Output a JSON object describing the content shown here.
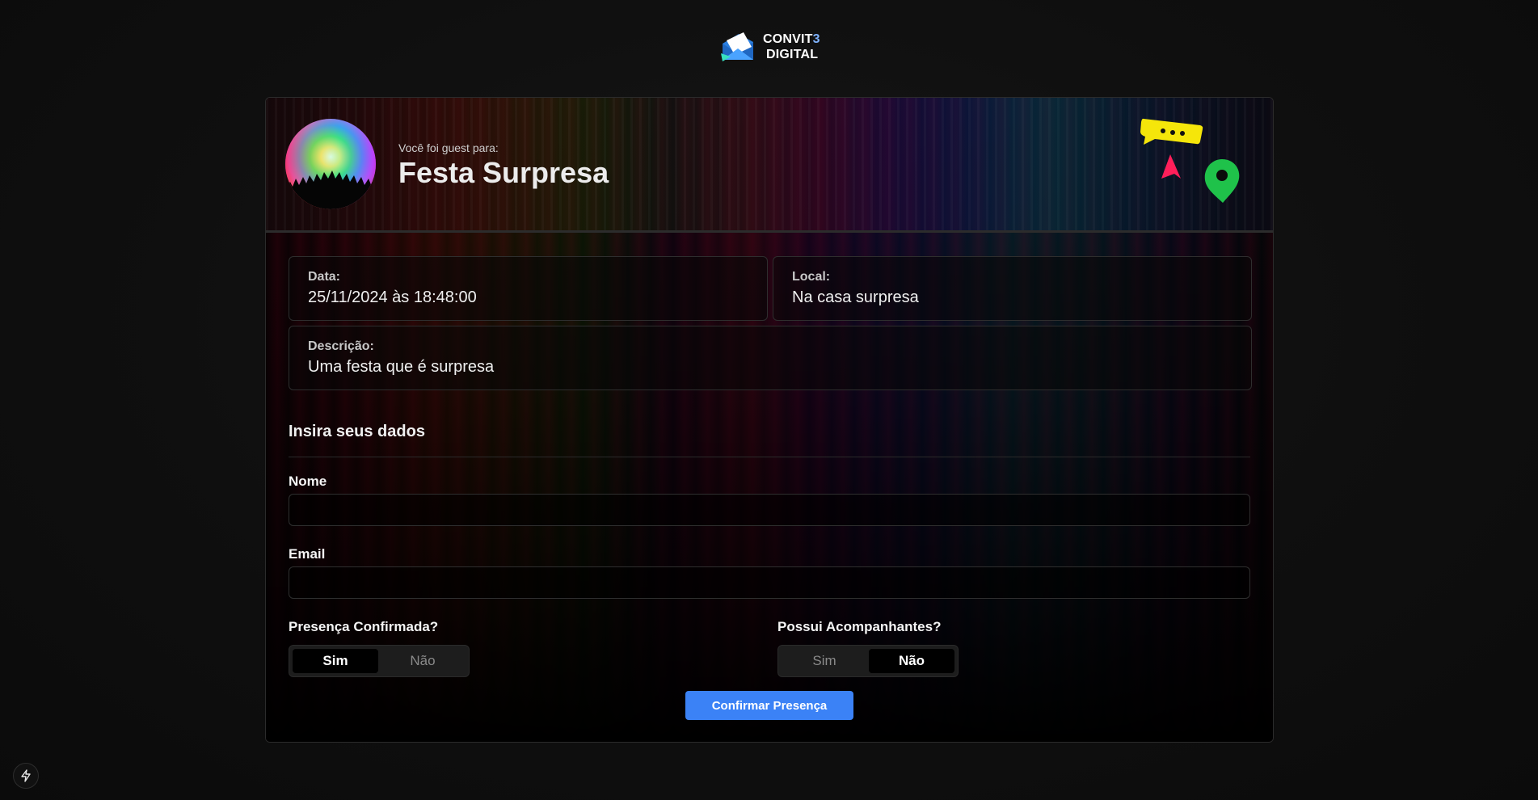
{
  "brand": {
    "line1": "CONVIT",
    "line1_accent": "3",
    "line2": "DIGITAL"
  },
  "header": {
    "subtitle": "Você foi guest para:",
    "title": "Festa Surpresa"
  },
  "info": {
    "date": {
      "label": "Data:",
      "value": "25/11/2024 às 18:48:00"
    },
    "location": {
      "label": "Local:",
      "value": "Na casa surpresa"
    },
    "description": {
      "label": "Descrição:",
      "value": "Uma festa que é surpresa"
    }
  },
  "form": {
    "section_title": "Insira seus dados",
    "name": {
      "label": "Nome",
      "value": "",
      "placeholder": ""
    },
    "email": {
      "label": "Email",
      "value": "",
      "placeholder": ""
    },
    "presence": {
      "label": "Presença Confirmada?",
      "options": [
        "Sim",
        "Não"
      ],
      "selected": "Sim"
    },
    "companions": {
      "label": "Possui Acompanhantes?",
      "options": [
        "Sim",
        "Não"
      ],
      "selected": "Não"
    },
    "submit_label": "Confirmar Presença"
  },
  "icons": {
    "logo": "envelope-logo-icon",
    "chat": "chat-bubble-icon",
    "cursor": "cursor-arrow-icon",
    "location": "map-pin-icon",
    "dev": "lightning-bolt-icon"
  },
  "colors": {
    "accent": "#3b82f6",
    "chat_bubble": "#f5e60a",
    "cursor": "#ff1f5a",
    "map_pin": "#1fc24a"
  }
}
